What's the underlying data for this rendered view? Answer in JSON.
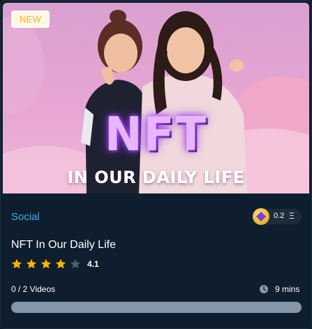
{
  "badge": "NEW",
  "thumbnail": {
    "title": "NFT",
    "subtitle": "IN OUR DAILY LIFE"
  },
  "category": "Social",
  "price": {
    "value": "0.2",
    "unit": "Ξ"
  },
  "course_title": "NFT In Our Daily Life",
  "rating": {
    "value": "4.1",
    "filled_stars": 4,
    "total_stars": 5
  },
  "videos": "0 / 2 Videos",
  "duration": "9 mins",
  "progress_fraction": 0,
  "colors": {
    "accent": "#4aa8e6",
    "star_filled": "#f7b500",
    "star_empty": "#4b5d6e",
    "badge_text": "#f3b21b"
  }
}
